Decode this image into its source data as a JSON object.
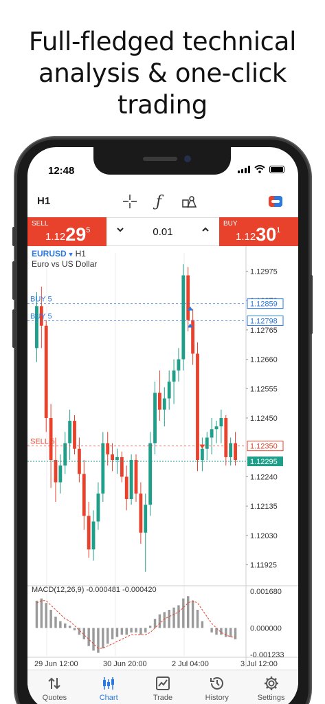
{
  "headline": {
    "line1": "Full-fledged technical",
    "line2": "analysis & one-click",
    "line3": "trading"
  },
  "status": {
    "time": "12:48"
  },
  "toolbar": {
    "timeframe": "H1"
  },
  "trade": {
    "sell": {
      "label": "SELL",
      "price_small": "1.12",
      "price_big": "29",
      "price_sup": "5"
    },
    "buy": {
      "label": "BUY",
      "price_small": "1.12",
      "price_big": "30",
      "price_sup": "1"
    },
    "volume": "0.01",
    "colors": {
      "sell": "#e8412c",
      "buy": "#e8412c"
    }
  },
  "chart": {
    "symbol": "EURUSD",
    "timeframe": "H1",
    "description": "Euro vs US Dollar",
    "macd_label": "MACD(12,26,9) -0.000481 -0.000420",
    "order_lines": [
      {
        "label": "BUY 5",
        "price": "1.12859"
      },
      {
        "label": "BUY 5",
        "price": "1.12798"
      },
      {
        "label": "SELL 5",
        "price": "1.12350"
      }
    ],
    "current_price": "1.12295",
    "price_ticks": [
      "1.12975",
      "1.12870",
      "1.12765",
      "1.12660",
      "1.12555",
      "1.12450",
      "1.12240",
      "1.12135",
      "1.12030",
      "1.11925"
    ],
    "macd_ticks": [
      "0.001680",
      "0.000000",
      "-0.001233"
    ],
    "time_ticks": [
      "29 Jun 12:00",
      "30 Jun 20:00",
      "2 Jul 04:00",
      "3 Jul 12:00"
    ],
    "colors": {
      "bull": "#1f9e8a",
      "bear": "#e8412c",
      "order_buy": "#2a7ae2",
      "order_sell": "#e8412c",
      "current": "#1f9e8a"
    }
  },
  "chart_data": {
    "type": "candlestick",
    "symbol": "EURUSD",
    "ylim": [
      1.1186,
      1.1304
    ],
    "candles": [
      [
        1.127,
        1.129,
        1.1265,
        1.1285
      ],
      [
        1.1285,
        1.1292,
        1.127,
        1.1278
      ],
      [
        1.1278,
        1.128,
        1.124,
        1.1245
      ],
      [
        1.1245,
        1.125,
        1.122,
        1.123
      ],
      [
        1.123,
        1.1238,
        1.1215,
        1.1222
      ],
      [
        1.1222,
        1.1232,
        1.1218,
        1.1228
      ],
      [
        1.1228,
        1.124,
        1.1225,
        1.1236
      ],
      [
        1.1236,
        1.1248,
        1.123,
        1.1244
      ],
      [
        1.1244,
        1.1246,
        1.1232,
        1.1234
      ],
      [
        1.1234,
        1.1238,
        1.1222,
        1.1225
      ],
      [
        1.1225,
        1.123,
        1.1205,
        1.121
      ],
      [
        1.121,
        1.1215,
        1.1195,
        1.1198
      ],
      [
        1.1198,
        1.1212,
        1.1194,
        1.1208
      ],
      [
        1.1208,
        1.1222,
        1.1205,
        1.1218
      ],
      [
        1.1218,
        1.124,
        1.1215,
        1.1236
      ],
      [
        1.1236,
        1.124,
        1.1228,
        1.1232
      ],
      [
        1.1232,
        1.1236,
        1.1226,
        1.123
      ],
      [
        1.123,
        1.1234,
        1.1225,
        1.1231
      ],
      [
        1.1231,
        1.1233,
        1.1222,
        1.1224
      ],
      [
        1.1224,
        1.1228,
        1.1212,
        1.1216
      ],
      [
        1.1216,
        1.1232,
        1.1214,
        1.123
      ],
      [
        1.123,
        1.1232,
        1.1215,
        1.1218
      ],
      [
        1.1218,
        1.1222,
        1.12,
        1.1204
      ],
      [
        1.1204,
        1.1218,
        1.119,
        1.1214
      ],
      [
        1.1214,
        1.124,
        1.121,
        1.1236
      ],
      [
        1.1236,
        1.1258,
        1.1232,
        1.1254
      ],
      [
        1.1254,
        1.1262,
        1.1244,
        1.1248
      ],
      [
        1.1248,
        1.1256,
        1.1242,
        1.1252
      ],
      [
        1.1252,
        1.1262,
        1.1248,
        1.1258
      ],
      [
        1.1258,
        1.1266,
        1.125,
        1.1262
      ],
      [
        1.1262,
        1.127,
        1.1258,
        1.1266
      ],
      [
        1.1266,
        1.13,
        1.1262,
        1.1296
      ],
      [
        1.1296,
        1.1299,
        1.1276,
        1.128
      ],
      [
        1.128,
        1.1284,
        1.1264,
        1.1268
      ],
      [
        1.1268,
        1.1272,
        1.1226,
        1.123
      ],
      [
        1.123,
        1.1238,
        1.1226,
        1.1234
      ],
      [
        1.1234,
        1.124,
        1.123,
        1.1238
      ],
      [
        1.1238,
        1.1245,
        1.1232,
        1.1241
      ],
      [
        1.1241,
        1.1244,
        1.1236,
        1.1242
      ],
      [
        1.1242,
        1.1248,
        1.1236,
        1.1245
      ],
      [
        1.1245,
        1.1246,
        1.1228,
        1.1231
      ],
      [
        1.1231,
        1.1238,
        1.1228,
        1.1236
      ],
      [
        1.1236,
        1.124,
        1.1228,
        1.123
      ]
    ],
    "macd": [
      0.0012,
      0.0013,
      0.0011,
      0.0008,
      0.0005,
      0.0003,
      0.0002,
      0.0001,
      -0.0001,
      -0.0003,
      -0.0005,
      -0.0008,
      -0.001,
      -0.0011,
      -0.0009,
      -0.0007,
      -0.0005,
      -0.0004,
      -0.0003,
      -0.0003,
      -0.0002,
      -0.0002,
      -0.0003,
      -0.0002,
      0.0001,
      0.0004,
      0.0006,
      0.0007,
      0.0008,
      0.0009,
      0.001,
      0.0013,
      0.0014,
      0.0012,
      0.0008,
      0.0003,
      0.0,
      -0.0002,
      -0.0003,
      -0.0003,
      -0.0004,
      -0.0004,
      -0.0005
    ],
    "signal": [
      0.0011,
      0.0012,
      0.0012,
      0.001,
      0.0008,
      0.0006,
      0.0004,
      0.0003,
      0.0001,
      -0.0001,
      -0.0003,
      -0.0005,
      -0.0007,
      -0.0009,
      -0.0009,
      -0.0008,
      -0.0007,
      -0.0006,
      -0.0005,
      -0.0004,
      -0.0003,
      -0.0003,
      -0.0003,
      -0.0003,
      -0.0002,
      0.0,
      0.0002,
      0.0004,
      0.0005,
      0.0006,
      0.0007,
      0.0009,
      0.0011,
      0.0012,
      0.0011,
      0.0008,
      0.0005,
      0.0002,
      0.0,
      -0.0002,
      -0.0003,
      -0.0004,
      -0.0004
    ],
    "macd_ylim": [
      -0.001233,
      0.00168
    ]
  },
  "tabs": [
    {
      "label": "Quotes",
      "icon": "quotes-icon",
      "active": false
    },
    {
      "label": "Chart",
      "icon": "chart-icon",
      "active": true
    },
    {
      "label": "Trade",
      "icon": "trade-icon",
      "active": false
    },
    {
      "label": "History",
      "icon": "history-icon",
      "active": false
    },
    {
      "label": "Settings",
      "icon": "settings-icon",
      "active": false
    }
  ]
}
